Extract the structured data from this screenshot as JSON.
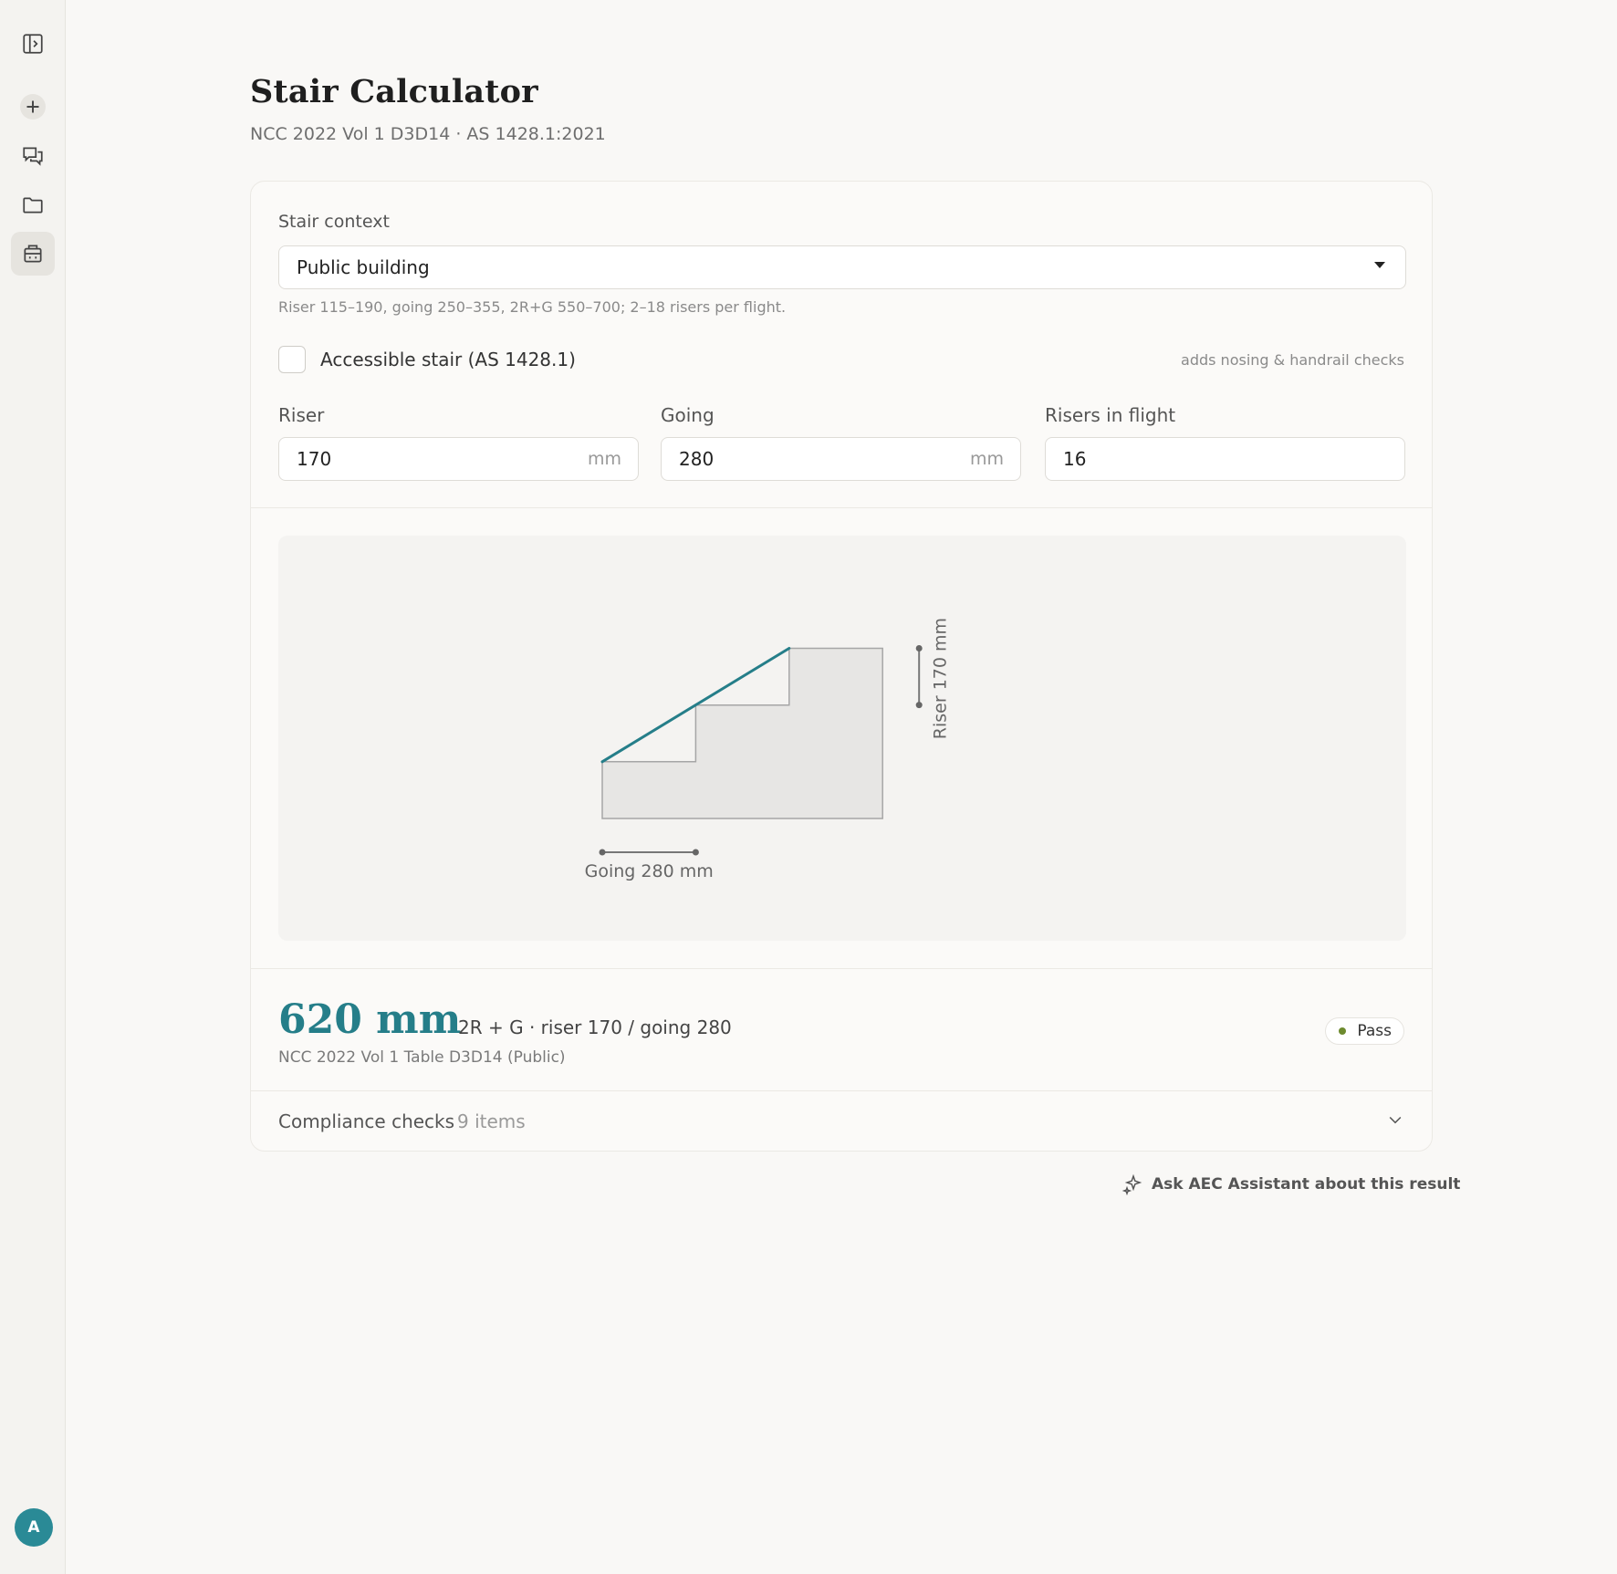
{
  "sidebar": {
    "icons": [
      "sidebar-toggle-icon",
      "plus-icon",
      "chat-icon",
      "folder-icon",
      "calculator-icon"
    ],
    "avatar_initial": "A"
  },
  "header": {
    "title": "Stair Calculator",
    "subtitle": "NCC 2022 Vol 1 D3D14 · AS 1428.1:2021"
  },
  "form": {
    "context_label": "Stair context",
    "context_value": "Public building",
    "context_hint": "Riser 115–190, going 250–355, 2R+G 550–700; 2–18 risers per flight.",
    "accessible_label": "Accessible stair (AS 1428.1)",
    "accessible_checked": false,
    "accessible_note": "adds nosing & handrail checks",
    "riser_label": "Riser",
    "riser_value": "170",
    "riser_unit": "mm",
    "going_label": "Going",
    "going_value": "280",
    "going_unit": "mm",
    "risers_label": "Risers in flight",
    "risers_value": "16"
  },
  "diagram": {
    "riser_mm": 170,
    "going_mm": 280,
    "steps_drawn": 3,
    "riser_label": "Riser 170 mm",
    "going_label": "Going 280 mm",
    "pitch_color": "#257e89"
  },
  "result": {
    "value": "620 mm",
    "formula": "2R + G · riser 170 / going 280",
    "reference": "NCC 2022 Vol 1 Table D3D14 (Public)",
    "status": "Pass",
    "status_color": "#6d8a2e"
  },
  "checks": {
    "title": "Compliance checks",
    "count": "9 items"
  },
  "assistant": {
    "label": "Ask AEC Assistant about this result"
  }
}
